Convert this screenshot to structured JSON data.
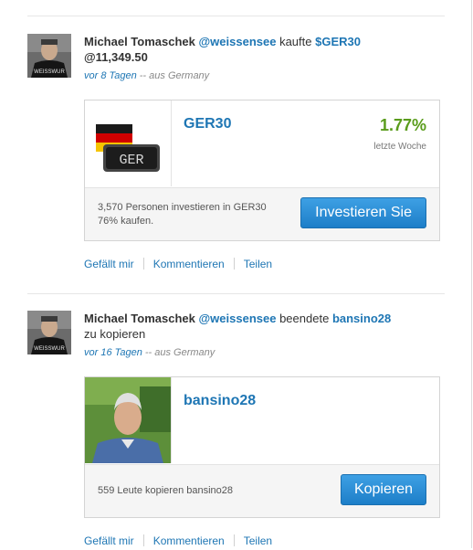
{
  "posts": [
    {
      "user": "Michael Tomaschek",
      "handle": "@weissensee",
      "action": "kaufte",
      "ticker": "$GER30",
      "price": "@11,349.50",
      "time_ago": "vor 8 Tagen",
      "location": "-- aus Germany",
      "card": {
        "title": "GER30",
        "percent": "1.77%",
        "percent_label": "letzte Woche",
        "badge_text": "GER",
        "footer_line1": "3,570 Personen investieren in GER30",
        "footer_line2": "76% kaufen.",
        "button": "Investieren Sie"
      },
      "actions": [
        "Gefällt mir",
        "Kommentieren",
        "Teilen"
      ]
    },
    {
      "user": "Michael Tomaschek",
      "handle": "@weissensee",
      "action": "beendete",
      "ticker": "bansino28",
      "action_tail": "zu kopieren",
      "time_ago": "vor 16 Tagen",
      "location": "-- aus Germany",
      "card": {
        "title": "bansino28",
        "footer_line1": "559 Leute kopieren bansino28",
        "button": "Kopieren"
      },
      "actions": [
        "Gefällt mir",
        "Kommentieren",
        "Teilen"
      ]
    }
  ],
  "avatar_shirt_text": "WEISSWUR",
  "colors": {
    "link": "#1e76b4",
    "positive": "#5a9c1c",
    "button": "#2b8ad6"
  }
}
